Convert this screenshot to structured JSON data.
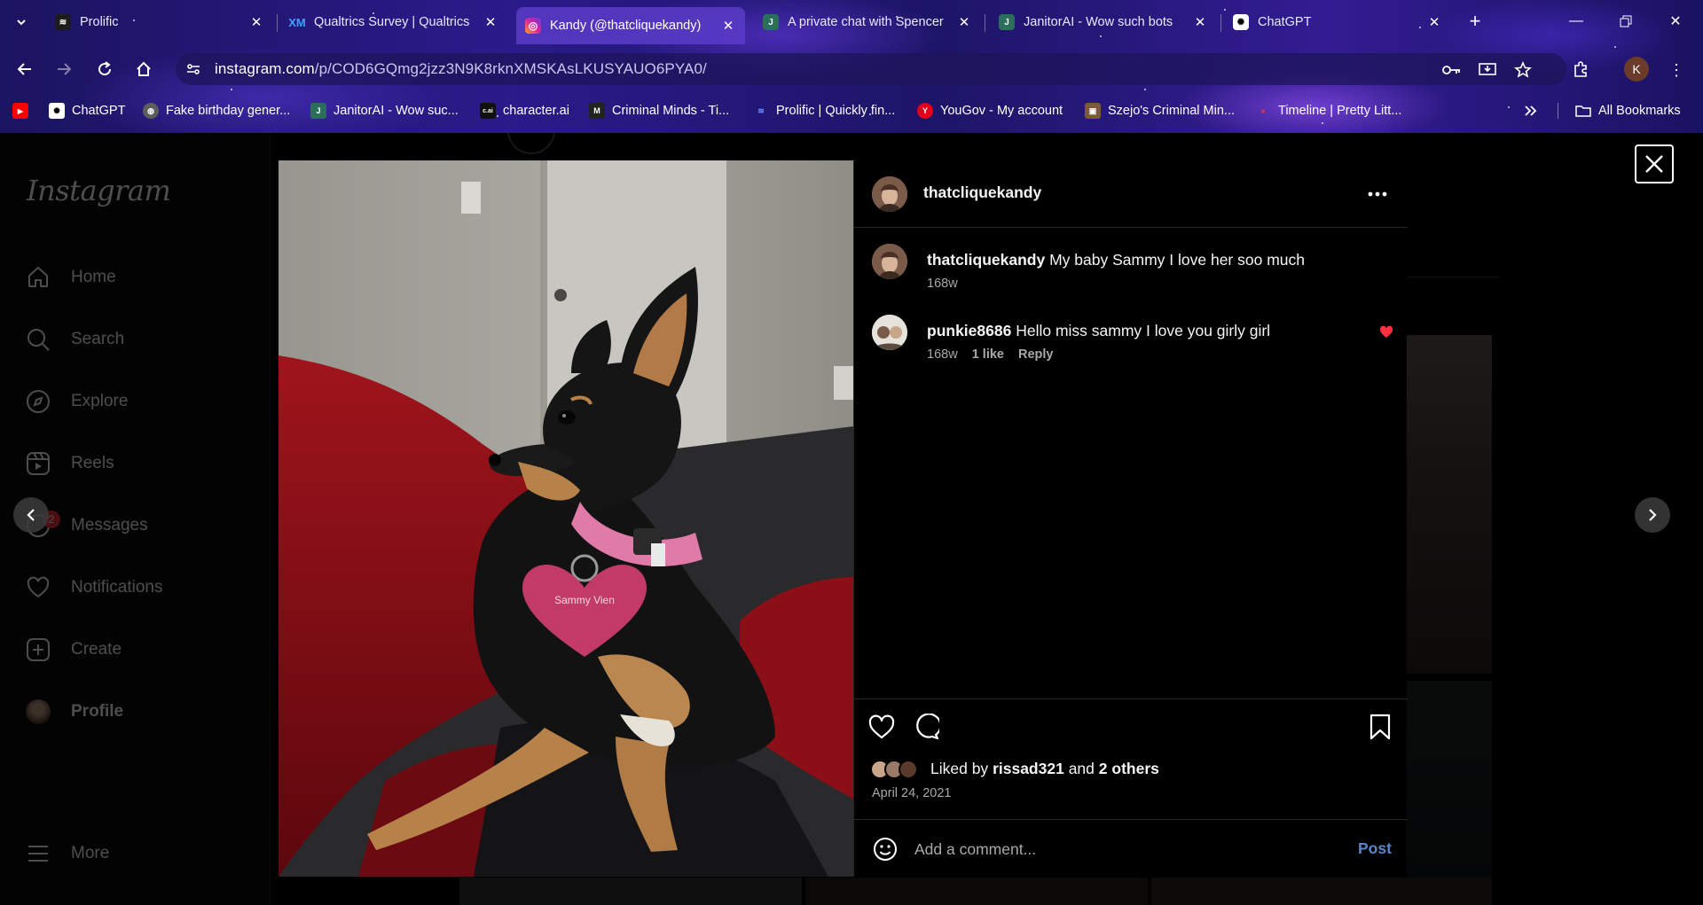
{
  "browser": {
    "tabs": [
      {
        "title": "Prolific",
        "favicon": "prolific-icon",
        "color": "#1c1c1c",
        "glyph": "≋"
      },
      {
        "title": "Qualtrics Survey | Qualtrics",
        "favicon": "qualtrics-icon",
        "color": "#1a73e8",
        "glyph": "XM"
      },
      {
        "title": "Kandy (@thatcliquekandy)",
        "favicon": "instagram-icon",
        "color": "#d6249f",
        "glyph": "◎"
      },
      {
        "title": "A private chat with Spencer",
        "favicon": "janitorai-icon",
        "color": "#2b6e5a",
        "glyph": "J"
      },
      {
        "title": "JanitorAI - Wow such bots",
        "favicon": "janitorai-icon",
        "color": "#2b6e5a",
        "glyph": "J"
      },
      {
        "title": "ChatGPT",
        "favicon": "chatgpt-icon",
        "color": "#3a3a3a",
        "glyph": "✺"
      }
    ],
    "url_host": "instagram.com",
    "url_path": "/p/COD6GQmg2jzz3N9K8rknXMSKAsLKUSYAUO6PYA0/",
    "profile_initial": "K",
    "bookmarks": [
      {
        "label": "",
        "icon": "youtube-icon",
        "color": "#ff0000",
        "glyph": "▶"
      },
      {
        "label": "ChatGPT",
        "icon": "chatgpt-icon",
        "color": "#3a3a3a",
        "glyph": "✺"
      },
      {
        "label": "Fake birthday gener...",
        "icon": "globe-icon",
        "color": "#555",
        "glyph": "◍"
      },
      {
        "label": "JanitorAI - Wow suc...",
        "icon": "janitorai-icon",
        "color": "#2b6e5a",
        "glyph": "J"
      },
      {
        "label": "character.ai",
        "icon": "characterai-icon",
        "color": "#111",
        "glyph": "c.ai"
      },
      {
        "label": "Criminal Minds - Ti...",
        "icon": "criminal-minds-icon",
        "color": "#222",
        "glyph": "M"
      },
      {
        "label": "Prolific | Quickly fin...",
        "icon": "prolific-icon",
        "color": "#1c1c1c",
        "glyph": "≋"
      },
      {
        "label": "YouGov - My account",
        "icon": "yougov-icon",
        "color": "#e2001a",
        "glyph": "Y"
      },
      {
        "label": "Szejo's Criminal Min...",
        "icon": "szejo-icon",
        "color": "#7a5a3a",
        "glyph": "▣"
      },
      {
        "label": "Timeline | Pretty Litt...",
        "icon": "pll-icon",
        "color": "#b0203a",
        "glyph": "♠"
      }
    ],
    "all_bookmarks": "All Bookmarks"
  },
  "sidebar": {
    "logo": "Instagram",
    "items": [
      {
        "label": "Home",
        "icon": "home-icon"
      },
      {
        "label": "Search",
        "icon": "search-icon"
      },
      {
        "label": "Explore",
        "icon": "explore-icon"
      },
      {
        "label": "Reels",
        "icon": "reels-icon"
      },
      {
        "label": "Messages",
        "icon": "messages-icon",
        "badge": "2"
      },
      {
        "label": "Notifications",
        "icon": "heart-icon"
      },
      {
        "label": "Create",
        "icon": "create-icon"
      },
      {
        "label": "Profile",
        "icon": "avatar"
      }
    ],
    "more": "More"
  },
  "post": {
    "username": "thatcliquekandy",
    "caption": {
      "user": "thatcliquekandy",
      "text": "My baby Sammy I love her soo much",
      "time": "168w"
    },
    "comments": [
      {
        "user": "punkie8686",
        "text": "Hello miss sammy I love you girly girl",
        "time": "168w",
        "likes": "1 like",
        "reply": "Reply",
        "liked": true
      }
    ],
    "liked_by_prefix": "Liked by",
    "liked_by_user": "rissad321",
    "liked_by_and": "and",
    "liked_by_others": "2 others",
    "date": "April 24, 2021",
    "comment_placeholder": "Add a comment...",
    "post_button": "Post",
    "tag_text": "Sammy Vien"
  },
  "colors": {
    "heart_red": "#ff3040",
    "post_blue": "#5a86c9",
    "collar_pink": "#e07aa8"
  }
}
